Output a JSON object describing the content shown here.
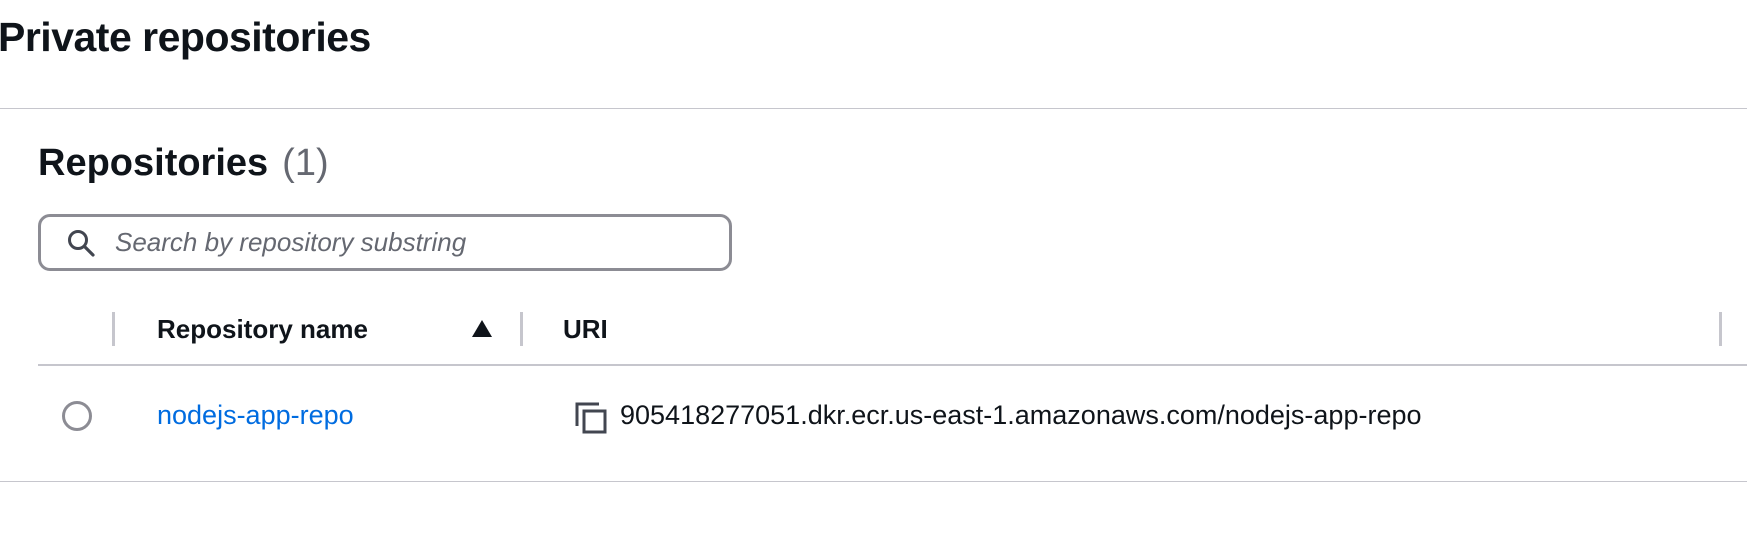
{
  "page": {
    "title": "Private repositories"
  },
  "repositories_panel": {
    "title": "Repositories",
    "count": "(1)",
    "search": {
      "placeholder": "Search by repository substring",
      "value": ""
    },
    "table": {
      "columns": [
        {
          "label": "Repository name",
          "sort": "ascending",
          "sort_icon": "caret-up-filled-icon"
        },
        {
          "label": "URI"
        }
      ],
      "rows": [
        {
          "selected": false,
          "name": "nodejs-app-repo",
          "uri": "905418277051.dkr.ecr.us-east-1.amazonaws.com/nodejs-app-repo",
          "copy_icon": "copy-icon"
        }
      ]
    }
  },
  "colors": {
    "link": "#006ce0",
    "text": "#0f141a",
    "muted": "#656871",
    "border": "#c6c6cd",
    "input_border": "#8c8c94"
  }
}
